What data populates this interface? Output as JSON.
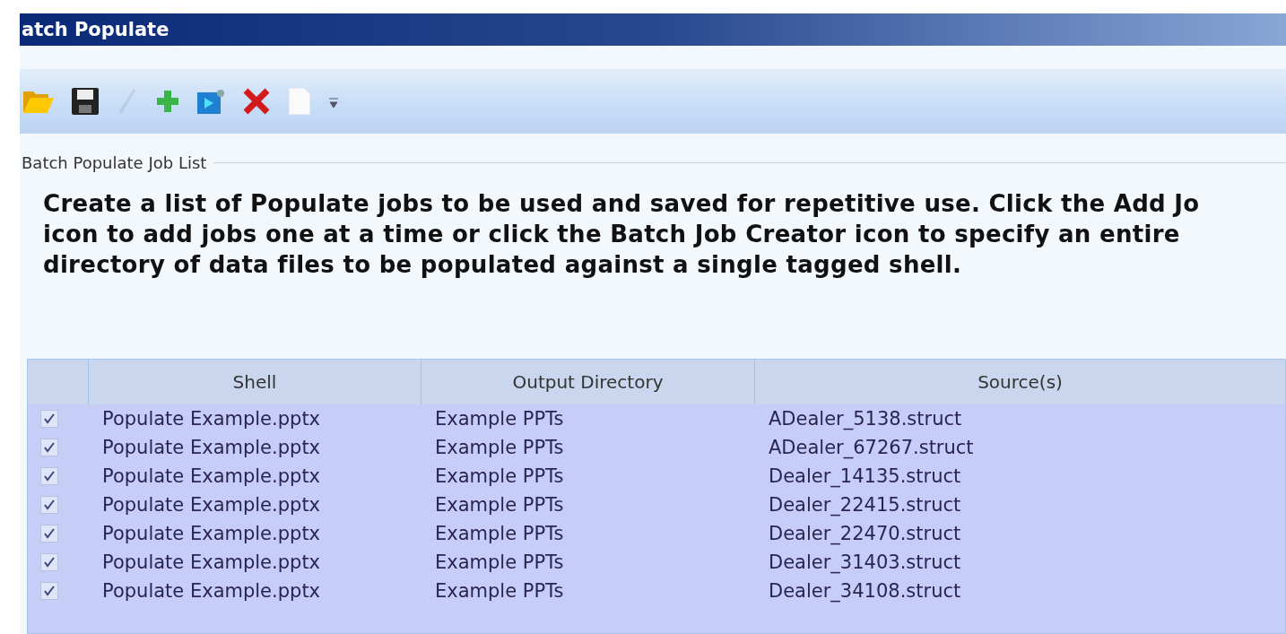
{
  "window": {
    "title": "atch Populate"
  },
  "toolbar": {
    "tools": [
      {
        "kind": "folder",
        "disabled": false
      },
      {
        "kind": "save",
        "disabled": false
      },
      {
        "kind": "edit",
        "disabled": true
      },
      {
        "kind": "add",
        "disabled": false
      },
      {
        "kind": "batch",
        "disabled": false
      },
      {
        "kind": "delete",
        "disabled": false
      },
      {
        "kind": "page",
        "disabled": false
      },
      {
        "kind": "overflow",
        "disabled": false
      }
    ]
  },
  "section": {
    "title": "Batch Populate Job List"
  },
  "instructions": [
    "Create a list of Populate jobs to be used and saved for repetitive use.  Click the Add Jo",
    "icon to add jobs one at a time or click the Batch Job Creator icon to specify an entire",
    "directory of data files to be populated against a single tagged shell."
  ],
  "table": {
    "columns": [
      "Shell",
      "Output Directory",
      "Source(s)"
    ],
    "rows": [
      {
        "checked": true,
        "shell": "Populate Example.pptx",
        "output": "Example PPTs",
        "source": "ADealer_5138.struct"
      },
      {
        "checked": true,
        "shell": "Populate Example.pptx",
        "output": "Example PPTs",
        "source": "ADealer_67267.struct"
      },
      {
        "checked": true,
        "shell": "Populate Example.pptx",
        "output": "Example PPTs",
        "source": "Dealer_14135.struct"
      },
      {
        "checked": true,
        "shell": "Populate Example.pptx",
        "output": "Example PPTs",
        "source": "Dealer_22415.struct"
      },
      {
        "checked": true,
        "shell": "Populate Example.pptx",
        "output": "Example PPTs",
        "source": "Dealer_22470.struct"
      },
      {
        "checked": true,
        "shell": "Populate Example.pptx",
        "output": "Example PPTs",
        "source": "Dealer_31403.struct"
      },
      {
        "checked": true,
        "shell": "Populate Example.pptx",
        "output": "Example PPTs",
        "source": "Dealer_34108.struct"
      }
    ]
  }
}
